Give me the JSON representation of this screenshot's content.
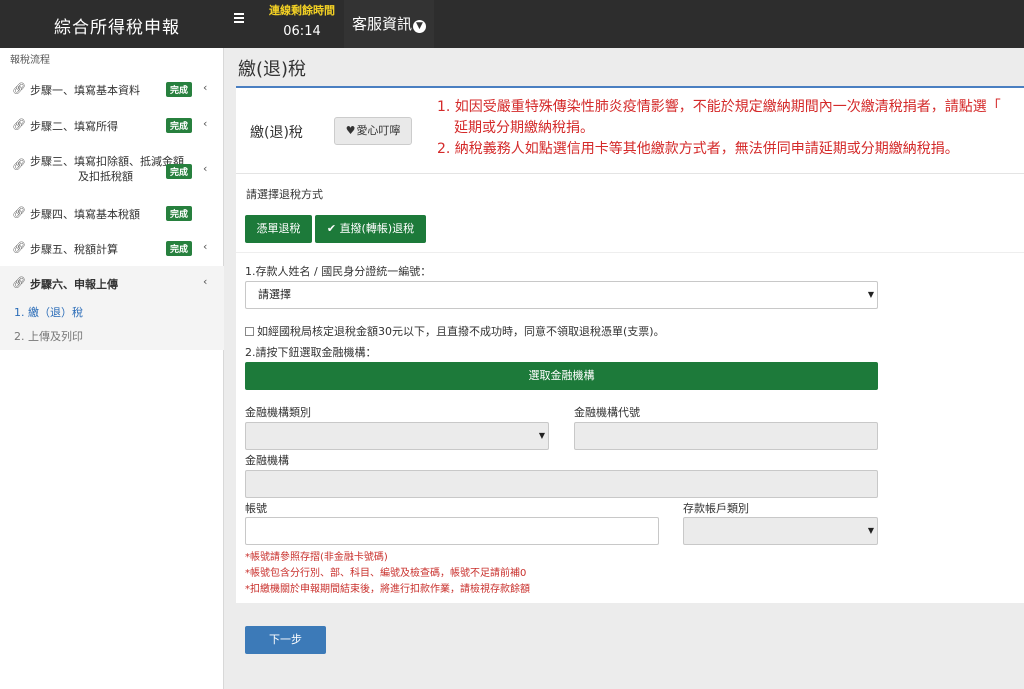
{
  "header": {
    "app_title": "綜合所得稅申報",
    "timer_label": "連線剩餘時間",
    "timer_value": "06:14",
    "service_menu": "客服資訊"
  },
  "sidebar": {
    "heading": "報稅流程",
    "badge_done": "完成",
    "steps": [
      {
        "label": "步驟一、填寫基本資料",
        "status": "完成"
      },
      {
        "label": "步驟二、填寫所得",
        "status": "完成"
      },
      {
        "label_line1": "步驟三、填寫扣除額、抵減金額",
        "label_line2": "及扣抵稅額",
        "status": "完成"
      },
      {
        "label": "步驟四、填寫基本稅額",
        "status": "完成"
      },
      {
        "label": "步驟五、稅額計算",
        "status": "完成"
      },
      {
        "label": "步驟六、申報上傳",
        "status": ""
      }
    ],
    "substeps": [
      "1. 繳（退）稅",
      "2. 上傳及列印"
    ]
  },
  "main": {
    "page_title": "繳(退)稅",
    "card_label": "繳(退)稅",
    "love_button": "愛心叮嚀",
    "notices": [
      "1. 如因受嚴重特殊傳染性肺炎疫情影響，不能於規定繳納期間內一次繳清稅捐者，請點選「",
      "延期或分期繳納稅捐。",
      "2. 納稅義務人如點選信用卡等其他繳款方式者，無法併同申請延期或分期繳納稅捐。"
    ],
    "refund_prompt": "請選擇退稅方式",
    "refund_options": [
      "憑單退稅",
      "直撥(轉帳)退稅"
    ],
    "selected_refund_option": "直撥(轉帳)退稅",
    "depositor_label": "1.存款人姓名 / 國民身分證統一編號：",
    "depositor_select_value": "請選擇",
    "checkbox_label": "如經國稅局核定退稅金額30元以下，且直撥不成功時，同意不領取退稅憑單(支票)。",
    "institution_prompt": "2.請按下鈕選取金融機構：",
    "institution_button": "選取金融機構",
    "inst_type_label": "金融機構類別",
    "inst_code_label": "金融機構代號",
    "inst_name_label": "金融機構",
    "account_label": "帳號",
    "account_type_label": "存款帳戶類別",
    "notes": [
      "*帳號請參照存摺(非金融卡號碼)",
      "*帳號包含分行別、部、科目、編號及檢查碼，帳號不足請前補0",
      "*扣繳機關於申報期間結束後，將進行扣款作業，請檢視存款餘額"
    ],
    "next_button": "下一步"
  },
  "colors": {
    "topbar": "#2d2d2d",
    "timer_label": "#f2d024",
    "primary_green": "#1d7a3a",
    "badge_green": "#27803e",
    "notice_red": "#d42a2a",
    "next_blue": "#3c7ab8"
  }
}
